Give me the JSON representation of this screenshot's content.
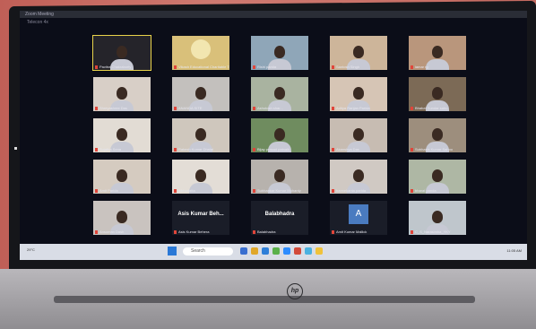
{
  "window": {
    "title": "Zoom Meeting",
    "subtitle": "Telecon 4x"
  },
  "participants": [
    {
      "name": "Pavitra Chakraborty",
      "active": true,
      "tone": "#25242a"
    },
    {
      "name": "Vikash Educational Charitable Trust",
      "logo": true,
      "tone": "#d9c07a"
    },
    {
      "name": "Rishi parida",
      "tone": "#8fa6b8"
    },
    {
      "name": "Santosh Singh",
      "tone": "#cdb59a"
    },
    {
      "name": "iamar rg",
      "tone": "#b9967c"
    },
    {
      "name": "Shreyashree Das",
      "tone": "#d8cfc7"
    },
    {
      "name": "ANANDA SITE",
      "tone": "#c3c0bd"
    },
    {
      "name": "Ashutosh shar...",
      "tone": "#a9b3a0"
    },
    {
      "name": "Aditya Ranjan Parida",
      "tone": "#d6c5b5"
    },
    {
      "name": "Bhabaf Sundar sahu",
      "tone": "#7c6a56"
    },
    {
      "name": "Sujatha Sena",
      "tone": "#e2dcd4"
    },
    {
      "name": "Rakesh Kumar Dhalai",
      "tone": "#cfc7bd"
    },
    {
      "name": "Bijay prasad patnaik",
      "tone": "#6f8c5f"
    },
    {
      "name": "Akanshya Das",
      "tone": "#c7bcb2"
    },
    {
      "name": "Subhasis Kumar Sahoo",
      "tone": "#9d8e7d"
    },
    {
      "name": "Amit Parida",
      "tone": "#d5cbc0"
    },
    {
      "name": "bibhudatta",
      "tone": "#e3ddd6"
    },
    {
      "name": "Subhankar Kumar Mohanty",
      "tone": "#b7b2ad"
    },
    {
      "name": "bannekanta parida",
      "tone": "#d0c9c3"
    },
    {
      "name": "bharat panda",
      "tone": "#aeb7a4"
    },
    {
      "name": "Ansuman Dash",
      "tone": "#c9c3bf"
    },
    {
      "name": "Asis Kumar Behera",
      "bigname": "Asis Kumar Beh...",
      "tone": "#1a1d28"
    },
    {
      "name": "Balabhadra",
      "bigname": "Balabhadra",
      "tone": "#1a1d28"
    },
    {
      "name": "Amit Kumar Mallick",
      "initial": "A",
      "tone": "#1a1d28"
    },
    {
      "name": "C_S_Narasimha_YKY",
      "tone": "#bfc6cc"
    }
  ],
  "taskbar": {
    "search": "Search",
    "weather": "29°C",
    "clock": "11:05 AM"
  },
  "laptop": {
    "brand": "hp"
  }
}
